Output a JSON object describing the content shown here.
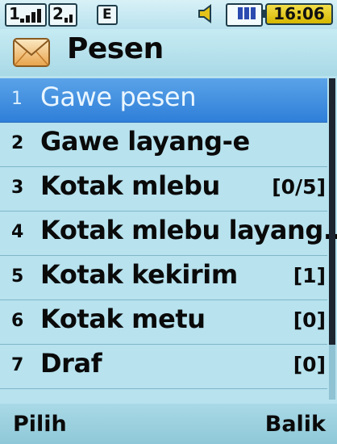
{
  "status": {
    "signal_sim1": "1",
    "signal_sim2": "2",
    "network_badge": "E",
    "clock": "16:06",
    "icons": [
      "signal-icon",
      "sim2-signal-icon",
      "edge-icon",
      "speaker-icon",
      "battery-icon"
    ]
  },
  "header": {
    "title": "Pesen",
    "icon": "envelope-icon"
  },
  "menu": [
    {
      "index": "1",
      "label": "Gawe pesen",
      "count": "",
      "selected": true
    },
    {
      "index": "2",
      "label": "Gawe layang-e",
      "count": ""
    },
    {
      "index": "3",
      "label": "Kotak mlebu",
      "count": "[0/5]"
    },
    {
      "index": "4",
      "label": "Kotak mlebu layang...",
      "count": ""
    },
    {
      "index": "5",
      "label": "Kotak kekirim",
      "count": "[1]"
    },
    {
      "index": "6",
      "label": "Kotak metu",
      "count": "[0]"
    },
    {
      "index": "7",
      "label": "Draf",
      "count": "[0]"
    }
  ],
  "softkeys": {
    "left": "Pilih",
    "right": "Balik"
  },
  "colors": {
    "background": "#b7e2ee",
    "selection": "#2f7fd9",
    "clock": "#e6c81c"
  }
}
